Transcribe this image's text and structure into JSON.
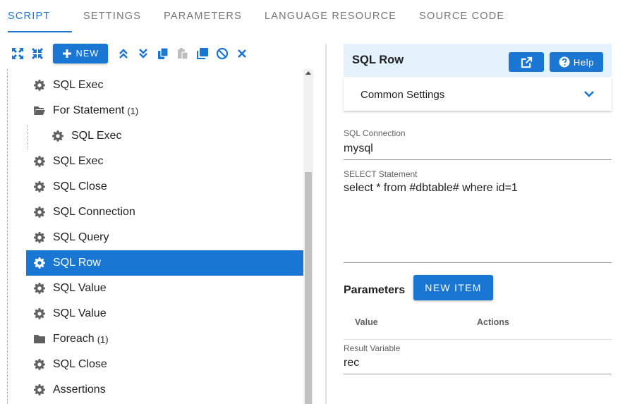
{
  "tabs": [
    {
      "label": "SCRIPT",
      "active": true
    },
    {
      "label": "SETTINGS"
    },
    {
      "label": "PARAMETERS"
    },
    {
      "label": "LANGUAGE RESOURCE"
    },
    {
      "label": "SOURCE CODE"
    }
  ],
  "toolbar": {
    "new_label": "NEW",
    "icons": [
      "expand-all-icon",
      "collapse-all-icon",
      "move-up-icon",
      "move-down-icon",
      "copy-icon",
      "paste-icon",
      "duplicate-icon",
      "disable-icon",
      "delete-icon"
    ]
  },
  "tree": {
    "items": [
      {
        "label": "SQL Exec",
        "icon": "gear-icon"
      },
      {
        "label": "For Statement",
        "count": "(1)",
        "icon": "folder-open-icon"
      },
      {
        "label": "SQL Exec",
        "icon": "gear-icon",
        "nested": true
      },
      {
        "label": "SQL Exec",
        "icon": "gear-icon"
      },
      {
        "label": "SQL Close",
        "icon": "gear-icon"
      },
      {
        "label": "SQL Connection",
        "icon": "gear-icon"
      },
      {
        "label": "SQL Query",
        "icon": "gear-icon"
      },
      {
        "label": "SQL Row",
        "icon": "gear-icon",
        "selected": true
      },
      {
        "label": "SQL Value",
        "icon": "gear-icon"
      },
      {
        "label": "SQL Value",
        "icon": "gear-icon"
      },
      {
        "label": "Foreach",
        "count": "(1)",
        "icon": "folder-icon"
      },
      {
        "label": "SQL Close",
        "icon": "gear-icon"
      },
      {
        "label": "Assertions",
        "icon": "gear-icon"
      }
    ]
  },
  "panel": {
    "title": "SQL Row",
    "help_label": "Help",
    "common_settings": "Common Settings",
    "sql_connection": {
      "label": "SQL Connection",
      "value": "mysql"
    },
    "select_statement": {
      "label": "SELECT Statement",
      "value": "select * from #dbtable# where id=1"
    },
    "parameters": {
      "title": "Parameters",
      "new_item_label": "NEW ITEM",
      "columns": [
        "Value",
        "Actions"
      ]
    },
    "result_variable": {
      "label": "Result Variable",
      "value": "rec"
    }
  },
  "colors": {
    "accent": "#1976d2",
    "panel_header": "#e3f2fd"
  }
}
